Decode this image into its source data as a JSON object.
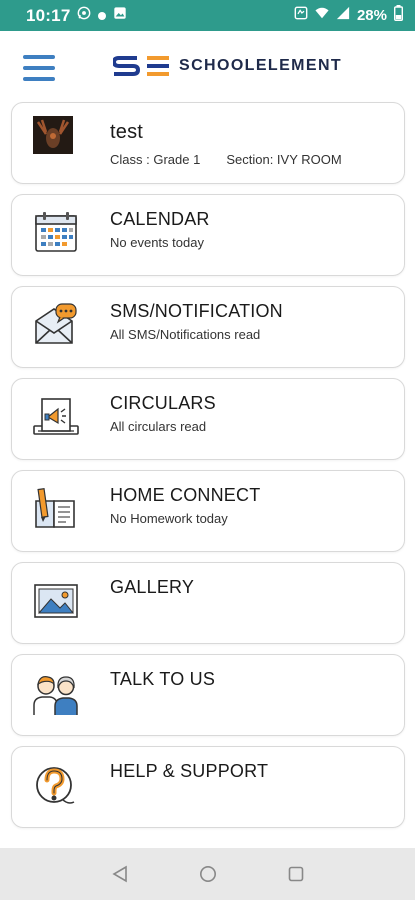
{
  "status_bar": {
    "time": "10:17",
    "battery": "28%"
  },
  "header": {
    "logo_text": "SCHOOLELEMENT",
    "menu_icon": "hamburger-icon"
  },
  "profile": {
    "name": "test",
    "class_label": "Class : Grade 1",
    "section_label": "Section: IVY ROOM"
  },
  "menu": [
    {
      "title": "CALENDAR",
      "subtitle": "No events today",
      "icon": "calendar-icon"
    },
    {
      "title": "SMS/NOTIFICATION",
      "subtitle": "All SMS/Notifications read",
      "icon": "envelope-chat-icon"
    },
    {
      "title": "CIRCULARS",
      "subtitle": "All circulars read",
      "icon": "megaphone-doc-icon"
    },
    {
      "title": "HOME CONNECT",
      "subtitle": "No Homework today",
      "icon": "book-pencil-icon"
    },
    {
      "title": "GALLERY",
      "subtitle": "",
      "icon": "picture-icon"
    },
    {
      "title": "TALK TO US",
      "subtitle": "",
      "icon": "people-icon"
    },
    {
      "title": "HELP & SUPPORT",
      "subtitle": "",
      "icon": "question-icon"
    }
  ],
  "colors": {
    "status_bar": "#2e9b8c",
    "accent_blue": "#3e7fc1",
    "accent_orange": "#f29a2e",
    "nav_bar": "#e8e8e8"
  }
}
